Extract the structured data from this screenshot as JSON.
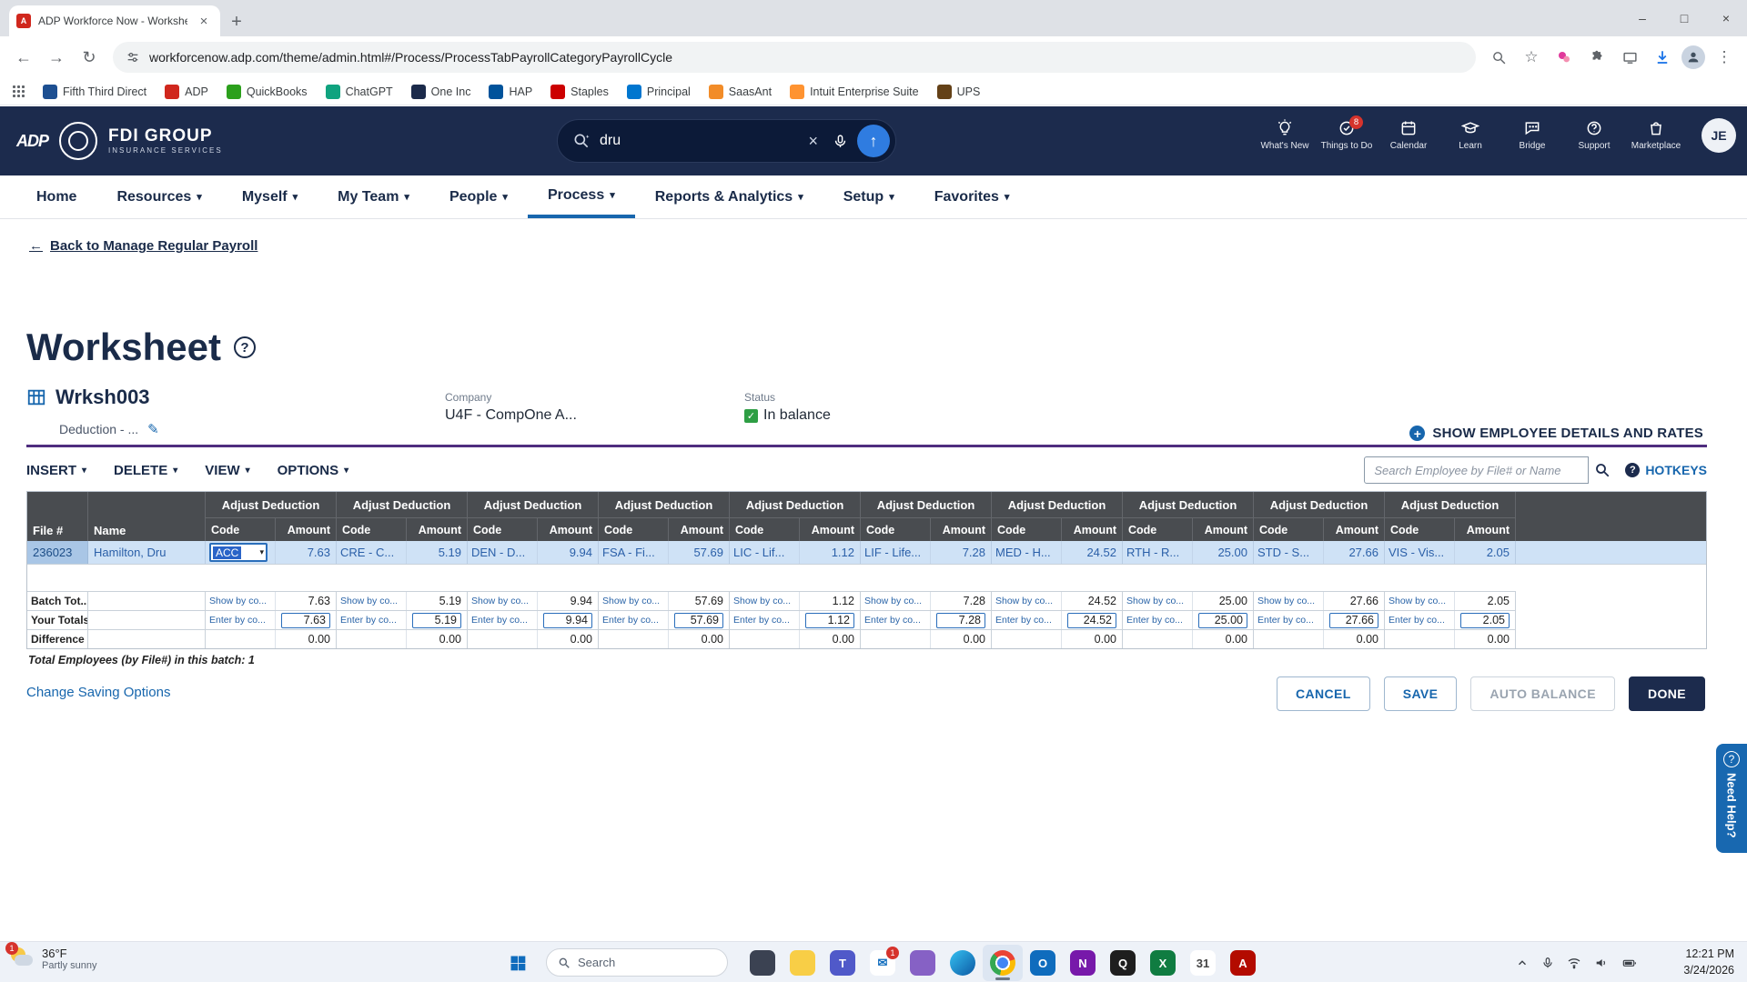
{
  "browser": {
    "tab_title": "ADP Workforce Now - Workshe...",
    "tab_favicon": "A",
    "url": "workforcenow.adp.com/theme/admin.html#/Process/ProcessTabPayrollCategoryPayrollCycle",
    "bookmarks": [
      {
        "label": "Fifth Third Direct",
        "color": "#1d4f91"
      },
      {
        "label": "ADP",
        "color": "#d0271d"
      },
      {
        "label": "QuickBooks",
        "color": "#2ca01c"
      },
      {
        "label": "ChatGPT",
        "color": "#10a37f"
      },
      {
        "label": "One Inc",
        "color": "#1b2a4a"
      },
      {
        "label": "HAP",
        "color": "#00539b"
      },
      {
        "label": "Staples",
        "color": "#cc0000"
      },
      {
        "label": "Principal",
        "color": "#0076cf"
      },
      {
        "label": "SaasAnt",
        "color": "#f28c28"
      },
      {
        "label": "Intuit Enterprise Suite",
        "color": "#ff9331"
      },
      {
        "label": "UPS",
        "color": "#644117"
      }
    ]
  },
  "header": {
    "adp_logo": "ADP",
    "brand": "FDI GROUP",
    "brand_sub": "INSURANCE SERVICES",
    "search": {
      "value": "dru"
    },
    "menu": [
      {
        "label": "What's New"
      },
      {
        "label": "Things to Do",
        "badge": "8"
      },
      {
        "label": "Calendar"
      },
      {
        "label": "Learn"
      },
      {
        "label": "Bridge"
      },
      {
        "label": "Support"
      },
      {
        "label": "Marketplace"
      }
    ],
    "avatar": "JE"
  },
  "nav": {
    "items": [
      "Home",
      "Resources",
      "Myself",
      "My Team",
      "People",
      "Process",
      "Reports & Analytics",
      "Setup",
      "Favorites"
    ]
  },
  "page": {
    "back_link": "Back to Manage Regular Payroll",
    "title": "Worksheet",
    "worksheet_name": "Wrksh003",
    "worksheet_type": "Deduction - ...",
    "company_label": "Company",
    "company_value": "U4F - CompOne A...",
    "status_label": "Status",
    "status_value": "In balance",
    "show_details": "SHOW EMPLOYEE DETAILS AND RATES"
  },
  "toolbar": {
    "insert": "INSERT",
    "delete": "DELETE",
    "view": "VIEW",
    "options": "OPTIONS",
    "search_placeholder": "Search Employee by File# or Name",
    "hotkeys": "HOTKEYS"
  },
  "table": {
    "file_header": "File #",
    "name_header": "Name",
    "adjust_label": "Adjust Deduction",
    "code_label": "Code",
    "amount_label": "Amount",
    "employee_file": "236023",
    "employee_name": "Hamilton, Dru",
    "selected_code": "ACC",
    "batch_label": "Batch Tot...",
    "your_label": "Your Totals",
    "diff_label": "Difference",
    "show_by_label": "Show by co...",
    "enter_by_label": "Enter by co...",
    "deductions": [
      {
        "code": "ACC",
        "amount": "7.63",
        "batch": "7.63",
        "yours": "7.63",
        "diff": "0.00"
      },
      {
        "code": "CRE - C...",
        "amount": "5.19",
        "batch": "5.19",
        "yours": "5.19",
        "diff": "0.00"
      },
      {
        "code": "DEN - D...",
        "amount": "9.94",
        "batch": "9.94",
        "yours": "9.94",
        "diff": "0.00"
      },
      {
        "code": "FSA - Fi...",
        "amount": "57.69",
        "batch": "57.69",
        "yours": "57.69",
        "diff": "0.00"
      },
      {
        "code": "LIC - Lif...",
        "amount": "1.12",
        "batch": "1.12",
        "yours": "1.12",
        "diff": "0.00"
      },
      {
        "code": "LIF - Life...",
        "amount": "7.28",
        "batch": "7.28",
        "yours": "7.28",
        "diff": "0.00"
      },
      {
        "code": "MED - H...",
        "amount": "24.52",
        "batch": "24.52",
        "yours": "24.52",
        "diff": "0.00"
      },
      {
        "code": "RTH - R...",
        "amount": "25.00",
        "batch": "25.00",
        "yours": "25.00",
        "diff": "0.00"
      },
      {
        "code": "STD - S...",
        "amount": "27.66",
        "batch": "27.66",
        "yours": "27.66",
        "diff": "0.00"
      },
      {
        "code": "VIS - Vis...",
        "amount": "2.05",
        "batch": "2.05",
        "yours": "2.05",
        "diff": "0.00"
      }
    ],
    "footer": "Total Employees (by File#) in this batch: 1"
  },
  "actions": {
    "change_saving": "Change Saving Options",
    "cancel": "CANCEL",
    "save": "SAVE",
    "auto_balance": "AUTO BALANCE",
    "done": "DONE"
  },
  "help_tab": "Need Help?",
  "taskbar": {
    "weather_temp": "36°F",
    "weather_desc": "Partly sunny",
    "weather_badge": "1",
    "search_placeholder": "Search",
    "apps": [
      {
        "name": "widgets",
        "bg": "#3b4252",
        "glyph": ""
      },
      {
        "name": "file-explorer",
        "bg": "#f8ce46",
        "glyph": ""
      },
      {
        "name": "teams",
        "bg": "#5059c9",
        "glyph": "T"
      },
      {
        "name": "mail",
        "bg": "#ffffff",
        "fg": "#0f6cbd",
        "glyph": "✉",
        "badge": "1"
      },
      {
        "name": "remote-desktop",
        "bg": "#8661c5",
        "glyph": ""
      },
      {
        "name": "edge",
        "bg": "linear-gradient(135deg,#35c1f1,#0c59a4)",
        "glyph": ""
      },
      {
        "name": "chrome",
        "bg": "radial-gradient(circle at 50% 50%, #4285f4 0 6px, #fff 6px 8px, transparent 8px), conic-gradient(from -45deg, #ea4335 0 33%, #fbbc05 0 66%, #34a853 0 100%)",
        "glyph": ""
      },
      {
        "name": "outlook",
        "bg": "#0f6cbd",
        "glyph": "O"
      },
      {
        "name": "onenote",
        "bg": "#7719aa",
        "glyph": "N"
      },
      {
        "name": "quickbooks",
        "bg": "#1e1e1e",
        "glyph": "Q"
      },
      {
        "name": "excel",
        "bg": "#107c41",
        "glyph": "X"
      },
      {
        "name": "calendar",
        "bg": "#ffffff",
        "fg": "#444444",
        "glyph": "31"
      },
      {
        "name": "acrobat",
        "bg": "#b30b00",
        "glyph": "A"
      }
    ],
    "time": "12:21 PM",
    "date": "3/24/2026"
  },
  "theme": {
    "header_bg": "#1c2b4d",
    "accent_blue": "#1766ad",
    "row_highlight": "#cfe2f6",
    "purple_rule": "#4f2d7f",
    "status_green": "#2e9e44"
  }
}
